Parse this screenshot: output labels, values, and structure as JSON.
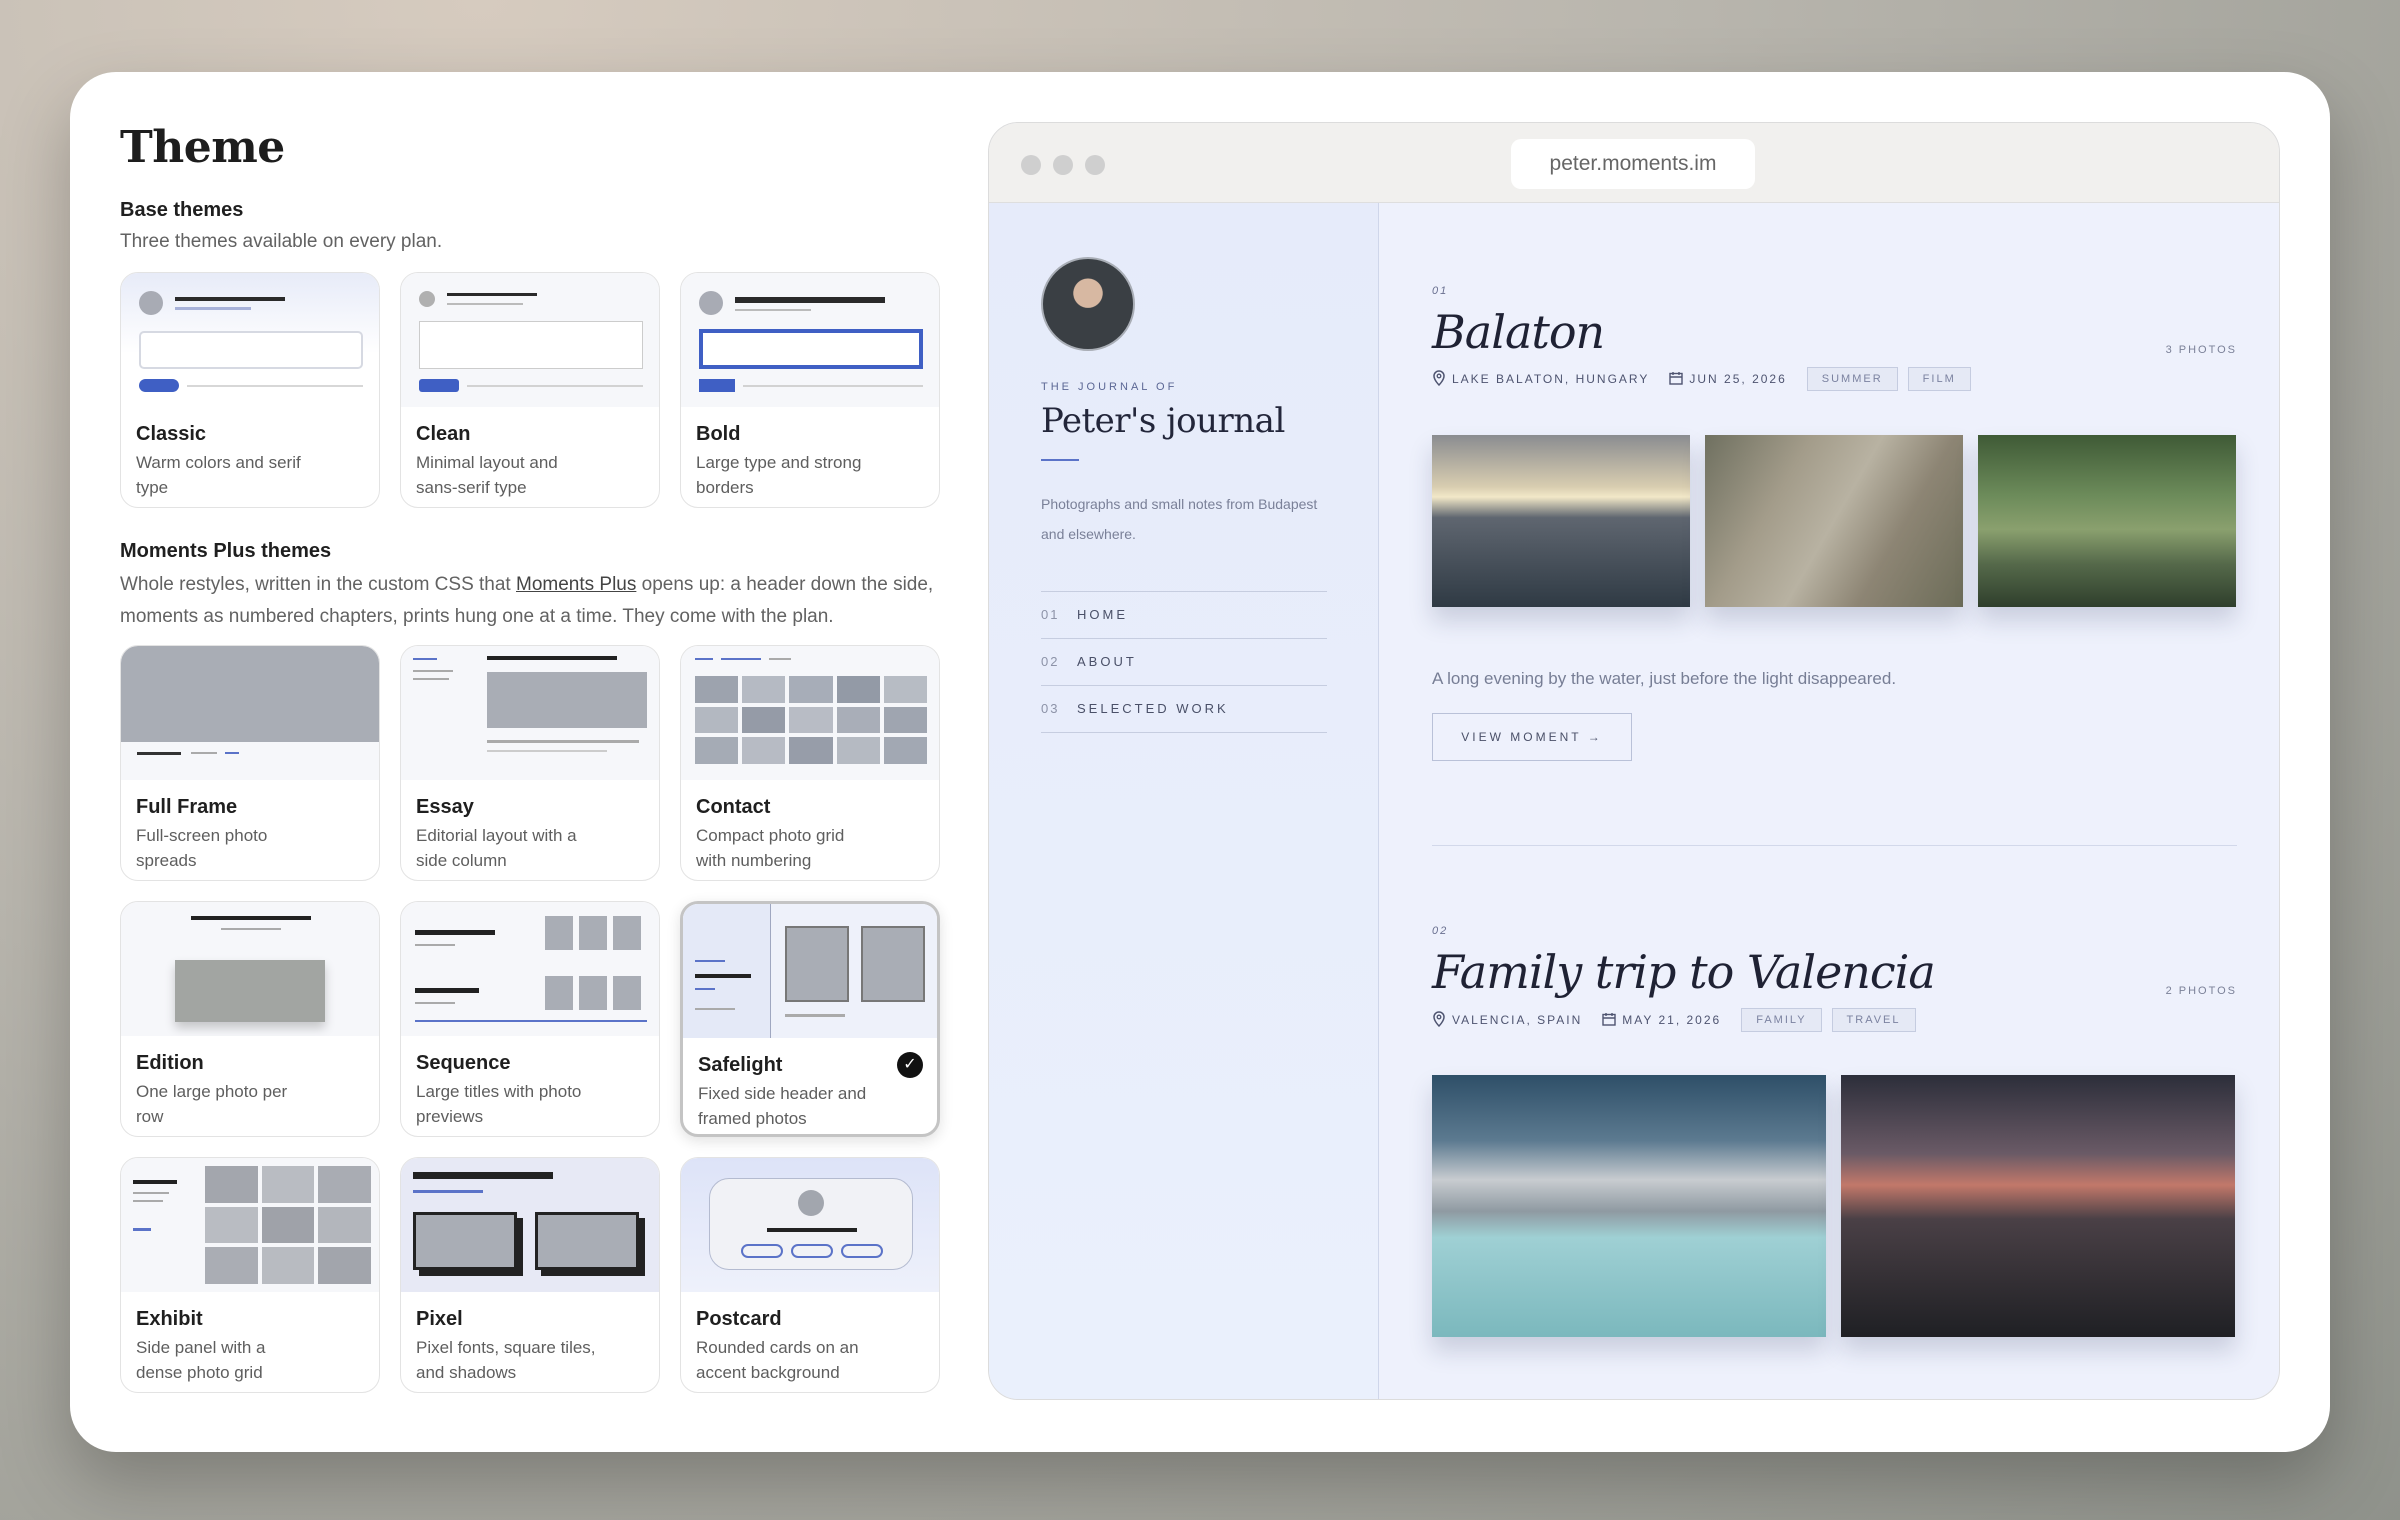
{
  "page": {
    "title": "Theme"
  },
  "base": {
    "title": "Base themes",
    "desc": "Three themes available on every plan.",
    "themes": [
      {
        "name": "Classic",
        "desc": "Warm colors and serif type"
      },
      {
        "name": "Clean",
        "desc": "Minimal layout and sans-serif type"
      },
      {
        "name": "Bold",
        "desc": "Large type and strong borders"
      }
    ]
  },
  "plus": {
    "title": "Moments Plus themes",
    "desc_pre": "Whole restyles, written in the custom CSS that ",
    "desc_link": "Moments Plus",
    "desc_post": " opens up: a header down the side, moments as numbered chapters, prints hung one at a time. They come with the plan.",
    "themes": [
      {
        "name": "Full Frame",
        "desc": "Full-screen photo spreads"
      },
      {
        "name": "Essay",
        "desc": "Editorial layout with a side column"
      },
      {
        "name": "Contact",
        "desc": "Compact photo grid with numbering"
      },
      {
        "name": "Edition",
        "desc": "One large photo per row"
      },
      {
        "name": "Sequence",
        "desc": "Large titles with photo previews"
      },
      {
        "name": "Safelight",
        "desc": "Fixed side header and framed photos",
        "selected": true
      },
      {
        "name": "Exhibit",
        "desc": "Side panel with a dense photo grid"
      },
      {
        "name": "Pixel",
        "desc": "Pixel fonts, square tiles, and shadows"
      },
      {
        "name": "Postcard",
        "desc": "Rounded cards on an accent background"
      }
    ]
  },
  "preview": {
    "url": "peter.moments.im",
    "journal_of": "THE JOURNAL OF",
    "journal_name": "Peter's journal",
    "journal_desc": "Photographs and small notes from Budapest and elsewhere.",
    "nav": [
      {
        "num": "01",
        "label": "HOME"
      },
      {
        "num": "02",
        "label": "ABOUT"
      },
      {
        "num": "03",
        "label": "SELECTED WORK"
      }
    ],
    "moments": [
      {
        "num": "01",
        "title": "Balaton",
        "count": "3 PHOTOS",
        "location": "LAKE BALATON, HUNGARY",
        "date": "JUN 25, 2026",
        "tags": [
          "SUMMER",
          "FILM"
        ],
        "caption": "A long evening by the water, just before the light disappeared.",
        "button": "VIEW MOMENT"
      },
      {
        "num": "02",
        "title": "Family trip to Valencia",
        "count": "2 PHOTOS",
        "location": "VALENCIA, SPAIN",
        "date": "MAY 21, 2026",
        "tags": [
          "FAMILY",
          "TRAVEL"
        ]
      }
    ]
  },
  "colors": {
    "accent": "#3f5fc4",
    "selected_check": "#111111"
  },
  "icons": {
    "location": "location-pin-icon",
    "date": "calendar-icon",
    "arrow": "arrow-right-icon",
    "check": "check-icon"
  }
}
